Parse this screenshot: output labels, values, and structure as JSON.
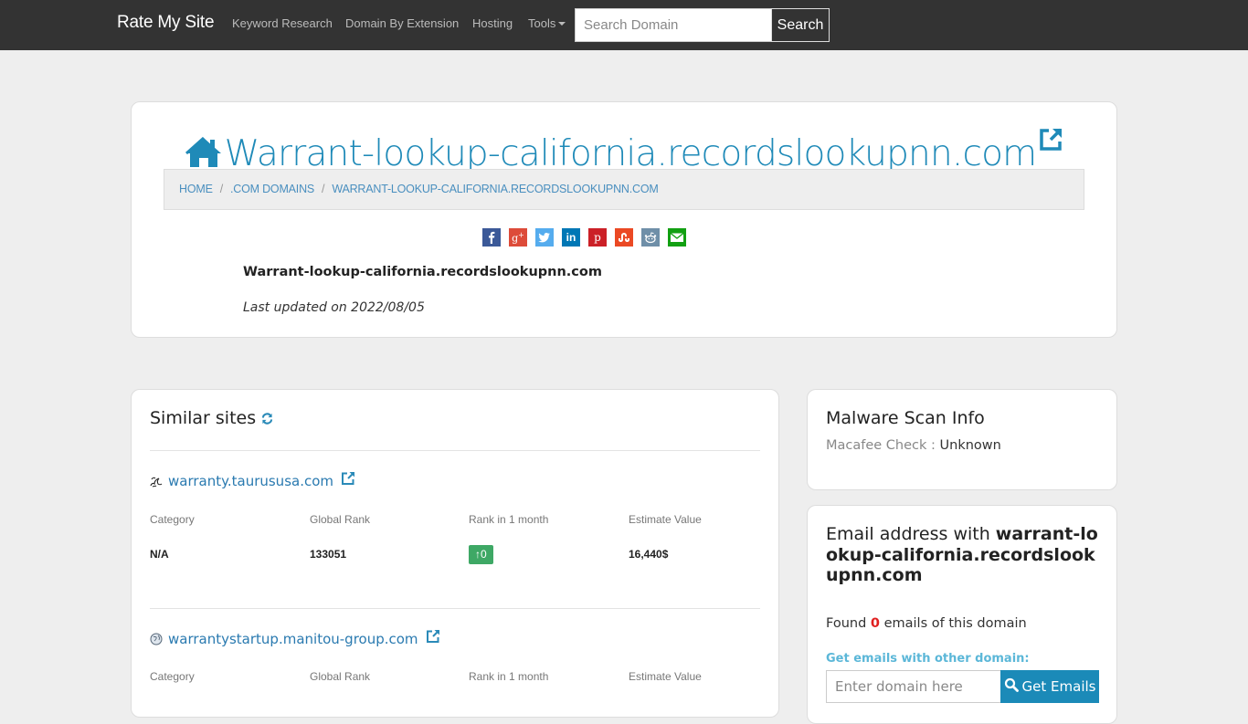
{
  "navbar": {
    "brand": "Rate My Site",
    "links": [
      {
        "label": "Keyword Research"
      },
      {
        "label": "Domain By Extension"
      },
      {
        "label": "Hosting"
      },
      {
        "label": "Tools"
      }
    ],
    "search_placeholder": "Search Domain",
    "search_button": "Search"
  },
  "header": {
    "title": "Warrant-lookup-california.recordslookupnn.com",
    "breadcrumb": [
      {
        "label": "Home"
      },
      {
        "label": ".com Domains"
      },
      {
        "label": "Warrant-lookup-california.recordslookupnn.com"
      }
    ],
    "share_buttons": [
      {
        "name": "facebook",
        "glyph": "f",
        "color": "#3b5998"
      },
      {
        "name": "google-plus",
        "glyph": "g+",
        "color": "#dd4b39"
      },
      {
        "name": "twitter",
        "glyph": "t",
        "color": "#55acee"
      },
      {
        "name": "linkedin",
        "glyph": "in",
        "color": "#0077b5"
      },
      {
        "name": "pinterest",
        "glyph": "p",
        "color": "#cb2027"
      },
      {
        "name": "stumbleupon",
        "glyph": "su",
        "color": "#eb4924"
      },
      {
        "name": "reddit",
        "glyph": "r",
        "color": "#6f8fa8"
      },
      {
        "name": "email",
        "glyph": "✉",
        "color": "#12a012"
      }
    ],
    "domain_bold": "Warrant-lookup-california.recordslookupnn.com",
    "last_updated": "Last updated on 2022/08/05"
  },
  "similar": {
    "title": "Similar sites",
    "column_labels": {
      "category": "Category",
      "global_rank": "Global Rank",
      "rank_month": "Rank in 1 month",
      "estimate": "Estimate Value"
    },
    "sites": [
      {
        "domain": "warranty.taurususa.com",
        "category": "N/A",
        "global_rank": "133051",
        "rank_change": "0",
        "estimate": "16,440$"
      },
      {
        "domain": "warrantystartup.manitou-group.com"
      }
    ]
  },
  "malware": {
    "title": "Malware Scan Info",
    "label": "Macafee Check : ",
    "value": "Unknown"
  },
  "email": {
    "title_prefix": "Email address with ",
    "title_domain": "warrant-lookup-california.recordslookupnn.com",
    "found_prefix": "Found ",
    "found_count": "0",
    "found_suffix": " emails of this domain",
    "other_label": "Get emails with other domain:",
    "input_placeholder": "Enter domain here",
    "button_label": "Get Emails"
  },
  "colors": {
    "accent": "#1f8ab8",
    "navbar_bg": "#333333",
    "page_bg": "#eeeeee",
    "badge_green": "#3ea865",
    "count_red": "#e02020"
  }
}
